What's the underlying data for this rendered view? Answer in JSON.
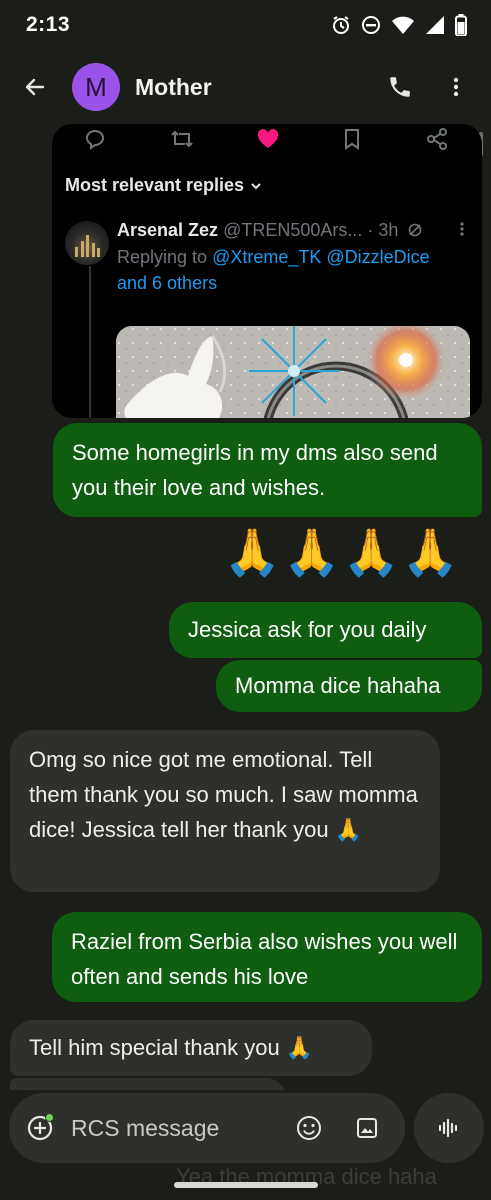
{
  "status_bar": {
    "time": "2:13"
  },
  "app_bar": {
    "avatar_letter": "M",
    "contact_name": "Mother"
  },
  "shared_post": {
    "section_label": "Most relevant replies",
    "author_name": "Arsenal Zez",
    "author_handle": "@TREN500Ars...",
    "time_ago": "· 3h",
    "replying_to_prefix": "Replying to",
    "mentions": "@Xtreme_TK @DizzleDice",
    "others": "and 6 others"
  },
  "messages": [
    {
      "direction": "outgoing",
      "text": "Some homegirls in my dms also send you their love and wishes."
    },
    {
      "direction": "outgoing",
      "text": "🙏🙏🙏🙏"
    },
    {
      "direction": "outgoing",
      "text": "Jessica ask for you daily"
    },
    {
      "direction": "outgoing",
      "text": "Momma dice hahaha"
    },
    {
      "direction": "incoming",
      "text": "Omg so nice got me emotional.  Tell them thank you so much.  I saw momma dice!   Jessica tell her thank you 🙏"
    },
    {
      "direction": "outgoing",
      "text": "Raziel from Serbia also wishes you well often and sends his love"
    },
    {
      "direction": "incoming",
      "text": "Tell him special thank you 🙏"
    }
  ],
  "composer": {
    "placeholder": "RCS message",
    "behind_text": "Yea the momma dice haha"
  },
  "colors": {
    "outgoing_bubble": "#0f5d0f",
    "incoming_bubble": "#2e302b",
    "background": "#1b1d19",
    "avatar": "#9a52e8"
  }
}
